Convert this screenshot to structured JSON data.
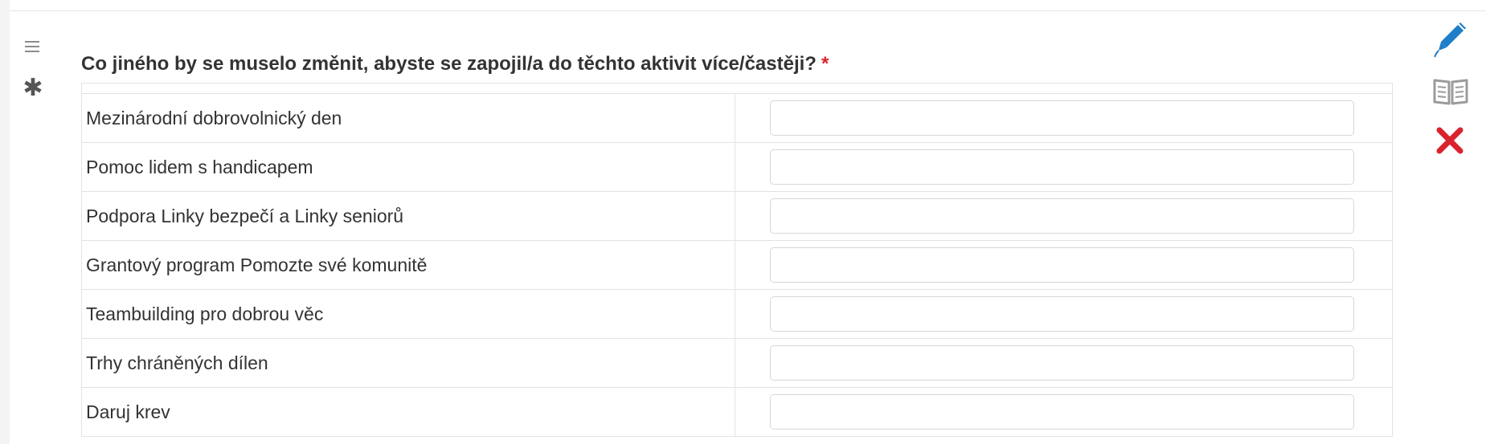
{
  "question": {
    "text": "Co jiného by se muselo změnit, abyste se zapojil/a do těchto aktivit více/častěji?",
    "required_marker": "*"
  },
  "rows": [
    {
      "label": "Mezinárodní dobrovolnický den",
      "value": ""
    },
    {
      "label": "Pomoc lidem s handicapem",
      "value": ""
    },
    {
      "label": "Podpora Linky bezpečí a Linky seniorů",
      "value": ""
    },
    {
      "label": "Grantový program Pomozte své komunitě",
      "value": ""
    },
    {
      "label": "Teambuilding pro dobrou věc",
      "value": ""
    },
    {
      "label": "Trhy chráněných dílen",
      "value": ""
    },
    {
      "label": "Daruj krev",
      "value": ""
    }
  ],
  "left_toolbar": {
    "icons": [
      "drag-handle-icon",
      "asterisk-icon"
    ]
  },
  "right_toolbar": {
    "icons": [
      "pencil-icon",
      "book-icon",
      "close-icon"
    ]
  },
  "colors": {
    "required": "#d9232d",
    "pencil": "#1f7ec8",
    "book": "#9b9b9b",
    "close": "#d9232d",
    "border": "#e3e3e3",
    "text": "#333333"
  }
}
